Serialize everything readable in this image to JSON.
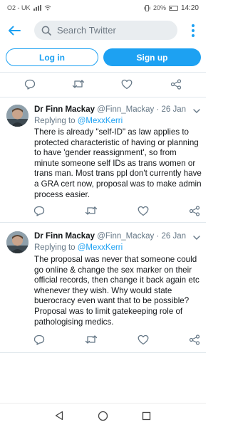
{
  "status_bar": {
    "carrier": "O2 - UK",
    "battery": "20%",
    "time": "14:20"
  },
  "header": {
    "search_placeholder": "Search Twitter"
  },
  "auth": {
    "login_label": "Log in",
    "signup_label": "Sign up"
  },
  "tweets": [
    {
      "display_name": "Dr Finn Mackay",
      "handle": "@Finn_Mackay",
      "separator": "·",
      "date": "26 Jan",
      "replying_prefix": "Replying to",
      "replying_to": "@MexxKerri",
      "text": "There is already \"self-ID\" as law applies to protected characteristic of having or planning to have 'gender reassignment', so from minute someone self IDs as trans women or trans man. Most trans ppl don't currently have a GRA cert now, proposal was to make admin process easier."
    },
    {
      "display_name": "Dr Finn Mackay",
      "handle": "@Finn_Mackay",
      "separator": "·",
      "date": "26 Jan",
      "replying_prefix": "Replying to",
      "replying_to": "@MexxKerri",
      "text": "The proposal was never that someone could go online & change the sex marker on their official records, then change it back again etc whenever they wish. Why would state buerocracy even want that to be possible? Proposal was to limit gatekeeping role of pathologising medics."
    }
  ],
  "colors": {
    "accent": "#1da1f2",
    "text": "#14171a",
    "muted": "#657786",
    "search_bg": "#e9edf0"
  },
  "icons": {
    "back": "arrow-left-icon",
    "search": "search-icon",
    "more": "more-vertical-icon",
    "reply": "reply-icon",
    "retweet": "retweet-icon",
    "like": "heart-icon",
    "share": "share-icon",
    "caret": "chevron-down-icon"
  }
}
